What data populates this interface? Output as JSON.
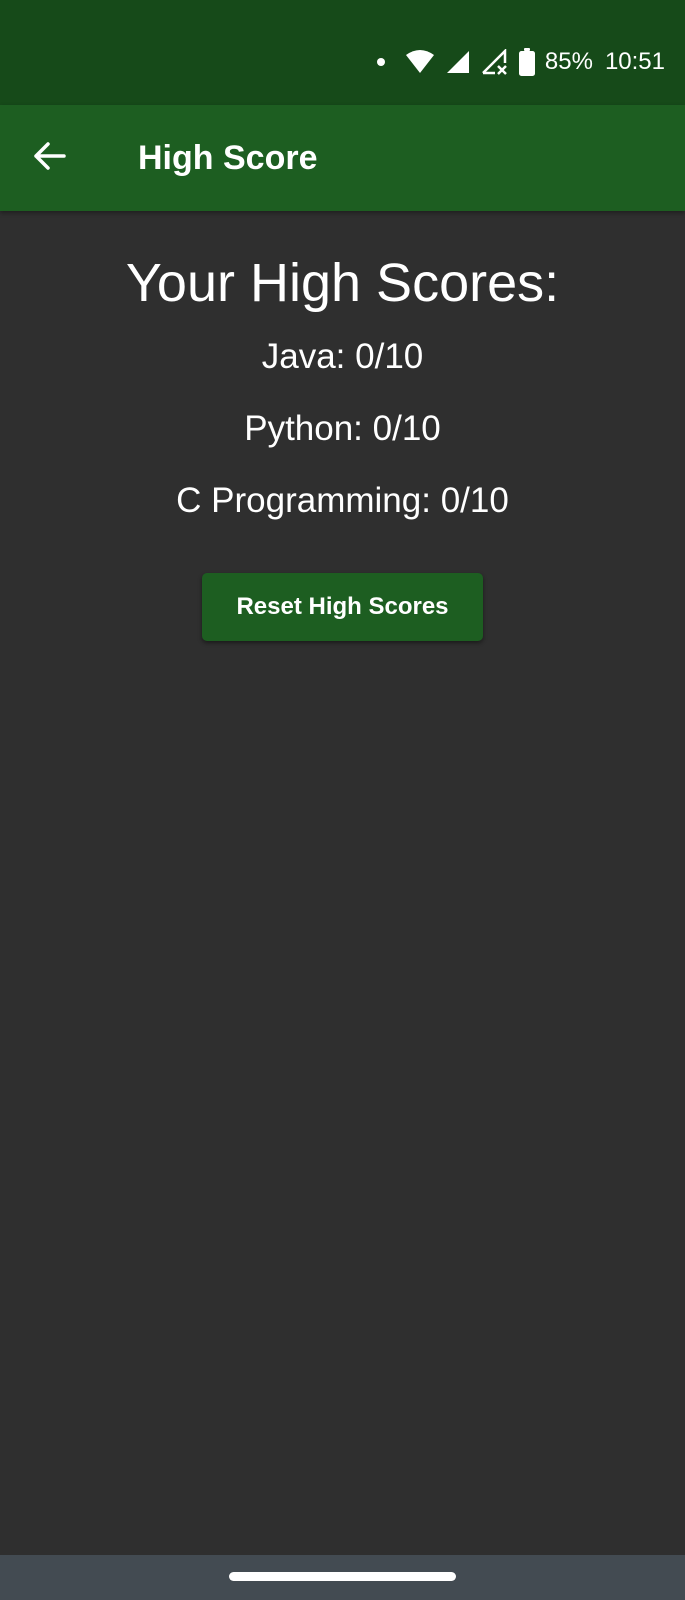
{
  "status_bar": {
    "battery_percent": "85%",
    "time": "10:51",
    "icons": [
      "notification-dot-icon",
      "wifi-icon",
      "signal-icon",
      "signal-no-data-icon",
      "battery-icon"
    ]
  },
  "app_bar": {
    "back_icon": "arrow-left-icon",
    "title": "High Score"
  },
  "content": {
    "heading": "Your High Scores:",
    "scores": [
      {
        "label": "Java: 0/10"
      },
      {
        "label": "Python: 0/10"
      },
      {
        "label": "C Programming: 0/10"
      }
    ],
    "reset_button_label": "Reset High Scores"
  },
  "colors": {
    "status_bar": "#164a19",
    "app_bar": "#1d5e21",
    "background": "#2f2f2f",
    "button": "#1d5e21",
    "nav_bar": "#434b52"
  }
}
